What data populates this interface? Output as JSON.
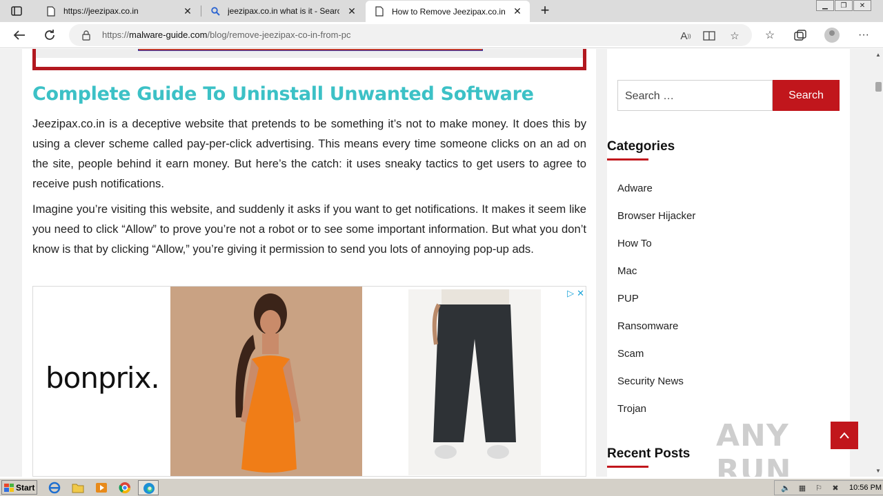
{
  "browser": {
    "tabs": [
      {
        "title": "https://jeezipax.co.in",
        "icon": "page-icon"
      },
      {
        "title": "jeezipax.co.in what is it - Search",
        "icon": "search-icon"
      },
      {
        "title": "How to Remove Jeezipax.co.in f",
        "icon": "page-icon"
      }
    ],
    "url_prefix": "https://",
    "url_domain": "malware-guide.com",
    "url_path": "/blog/remove-jeezipax-co-in-from-pc"
  },
  "article": {
    "heading": "Complete Guide To Uninstall Unwanted Software",
    "paragraph1": "Jeezipax.co.in is a deceptive website that pretends to be something it’s not to make money. It does this by using a clever scheme called pay-per-click advertising. This means every time someone clicks on an ad on the site, people behind it earn money. But here’s the catch: it uses sneaky tactics to get users to agree to receive push notifications.",
    "paragraph2": "Imagine you’re visiting this website, and suddenly it asks if you want to get notifications. It makes it seem like you need to click “Allow” to prove you’re not a robot or to see some important information. But what you don’t know is that by clicking “Allow,” you’re giving it permission to send you lots of annoying pop-up ads."
  },
  "ad": {
    "brand": "bonprix."
  },
  "sidebar": {
    "search_placeholder": "Search …",
    "search_button": "Search",
    "categories_title": "Categories",
    "categories": [
      "Adware",
      "Browser Hijacker",
      "How To",
      "Mac",
      "PUP",
      "Ransomware",
      "Scam",
      "Security News",
      "Trojan"
    ],
    "recent_posts_title": "Recent Posts"
  },
  "watermark": "ANY RUN",
  "taskbar": {
    "start_label": "Start",
    "clock": "10:56 PM"
  },
  "colors": {
    "accent_red": "#c1161c",
    "heading_teal": "#3cc1c6"
  }
}
